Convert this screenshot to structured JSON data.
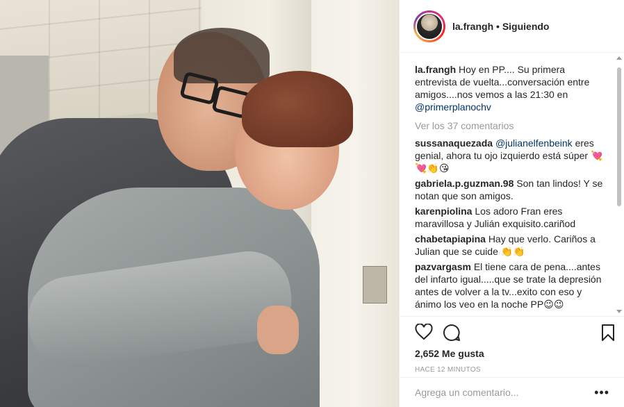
{
  "header": {
    "username": "la.frangh",
    "separator": " • ",
    "follow_status": "Siguiendo"
  },
  "caption": {
    "username": "la.frangh",
    "text": "Hoy en PP.... Su primera entrevista de vuelta...conversación entre amigos....nos vemos a las 21:30 en ",
    "mention": "@primerplanochv"
  },
  "view_all": "Ver los 37 comentarios",
  "comments": [
    {
      "username": "sussanaquezada",
      "mention": "@julianelfenbeink",
      "text": " eres genial, ahora tu ojo izquierdo está súper 💘💘👏😘"
    },
    {
      "username": "gabriela.p.guzman.98",
      "mention": "",
      "text": "Son tan lindos! Y se notan que son amigos."
    },
    {
      "username": "karenpiolina",
      "mention": "",
      "text": "Los adoro Fran eres maravillosa y Julián exquisito.cariñod"
    },
    {
      "username": "chabetapiapina",
      "mention": "",
      "text": "Hay que verlo. Cariños a Julian que se cuide 👏👏"
    },
    {
      "username": "pazvargasm",
      "mention": "",
      "text": "El tiene cara de pena....antes del infarto igual.....que se trate la depresión antes de volver a la tv...exito con eso y ánimo los veo en la noche PP😉😉"
    }
  ],
  "likes": "2,652 Me gusta",
  "time": "HACE 12 MINUTOS",
  "add_comment": {
    "placeholder": "Agrega un comentario...",
    "more": "•••"
  },
  "icons": {
    "like": "heart-icon",
    "comment": "comment-bubble-icon",
    "save": "bookmark-icon",
    "more": "more-options-icon"
  }
}
